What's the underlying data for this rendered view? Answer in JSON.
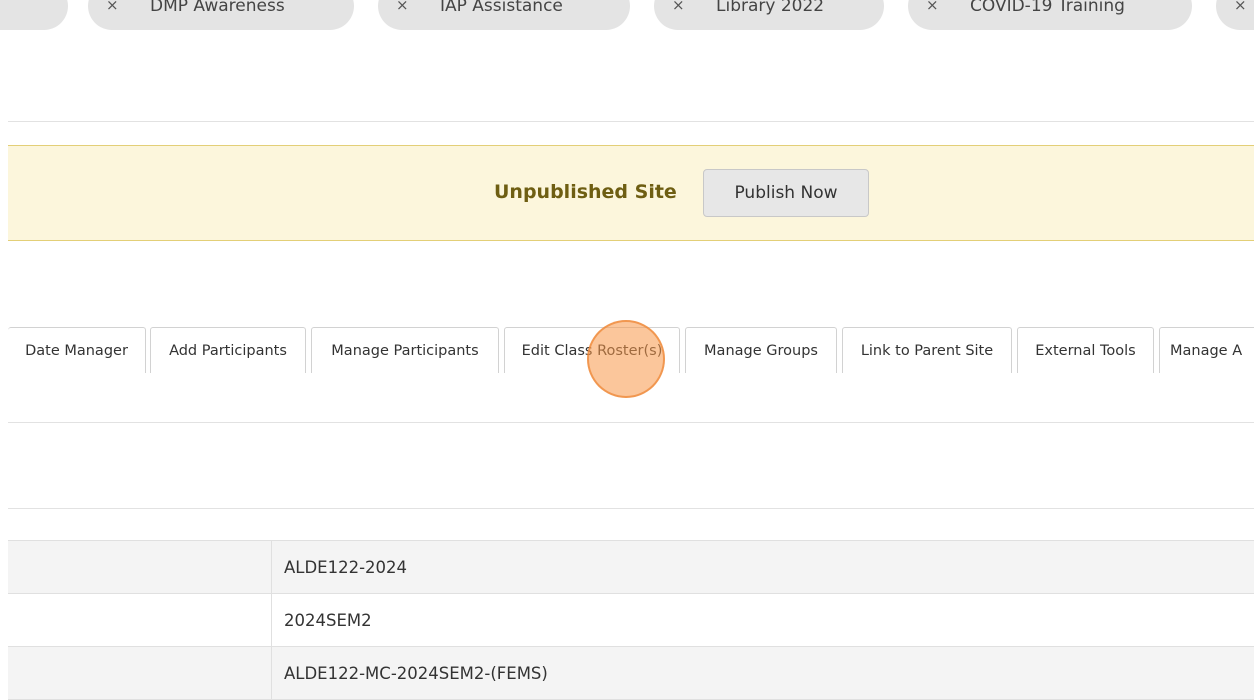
{
  "site_pills": [
    {
      "close_icon": "×",
      "label": ""
    },
    {
      "close_icon": "×",
      "label": "DMP Awareness"
    },
    {
      "close_icon": "×",
      "label": "IAP Assistance"
    },
    {
      "close_icon": "×",
      "label": "Library 2022"
    },
    {
      "close_icon": "×",
      "label": "COVID-19 Training"
    },
    {
      "close_icon": "×",
      "label": ""
    }
  ],
  "banner": {
    "text": "Unpublished Site",
    "publish_button": "Publish Now",
    "background_color": "#fcf6dc",
    "text_color": "#6e5e12"
  },
  "tabs": [
    {
      "label": "Date Manager"
    },
    {
      "label": "Add Participants"
    },
    {
      "label": "Manage Participants"
    },
    {
      "label": "Edit Class Roster(s)"
    },
    {
      "label": "Manage Groups"
    },
    {
      "label": "Link to Parent Site"
    },
    {
      "label": "External Tools"
    },
    {
      "label": "Manage A"
    }
  ],
  "site_info": {
    "rows": [
      {
        "label": "",
        "value": "ALDE122-2024"
      },
      {
        "label": "",
        "value": "2024SEM2"
      },
      {
        "label": "",
        "value": "ALDE122-MC-2024SEM2-(FEMS)"
      }
    ]
  },
  "highlight_color": "#f79848"
}
